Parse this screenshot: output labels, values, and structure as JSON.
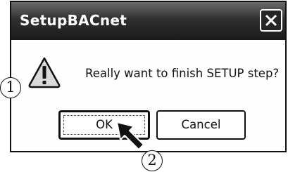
{
  "dialog": {
    "title": "SetupBACnet",
    "message": "Really want to finish SETUP step?",
    "buttons": {
      "ok": "OK",
      "cancel": "Cancel"
    },
    "icons": {
      "close": "close-icon",
      "warning": "warning-icon"
    }
  },
  "annotations": {
    "callout_1": "1",
    "callout_2": "2"
  },
  "colors": {
    "titlebar": "#2b2b2b",
    "title_text": "#ffffff",
    "warning_icon_fill": "#d9d9d9"
  }
}
